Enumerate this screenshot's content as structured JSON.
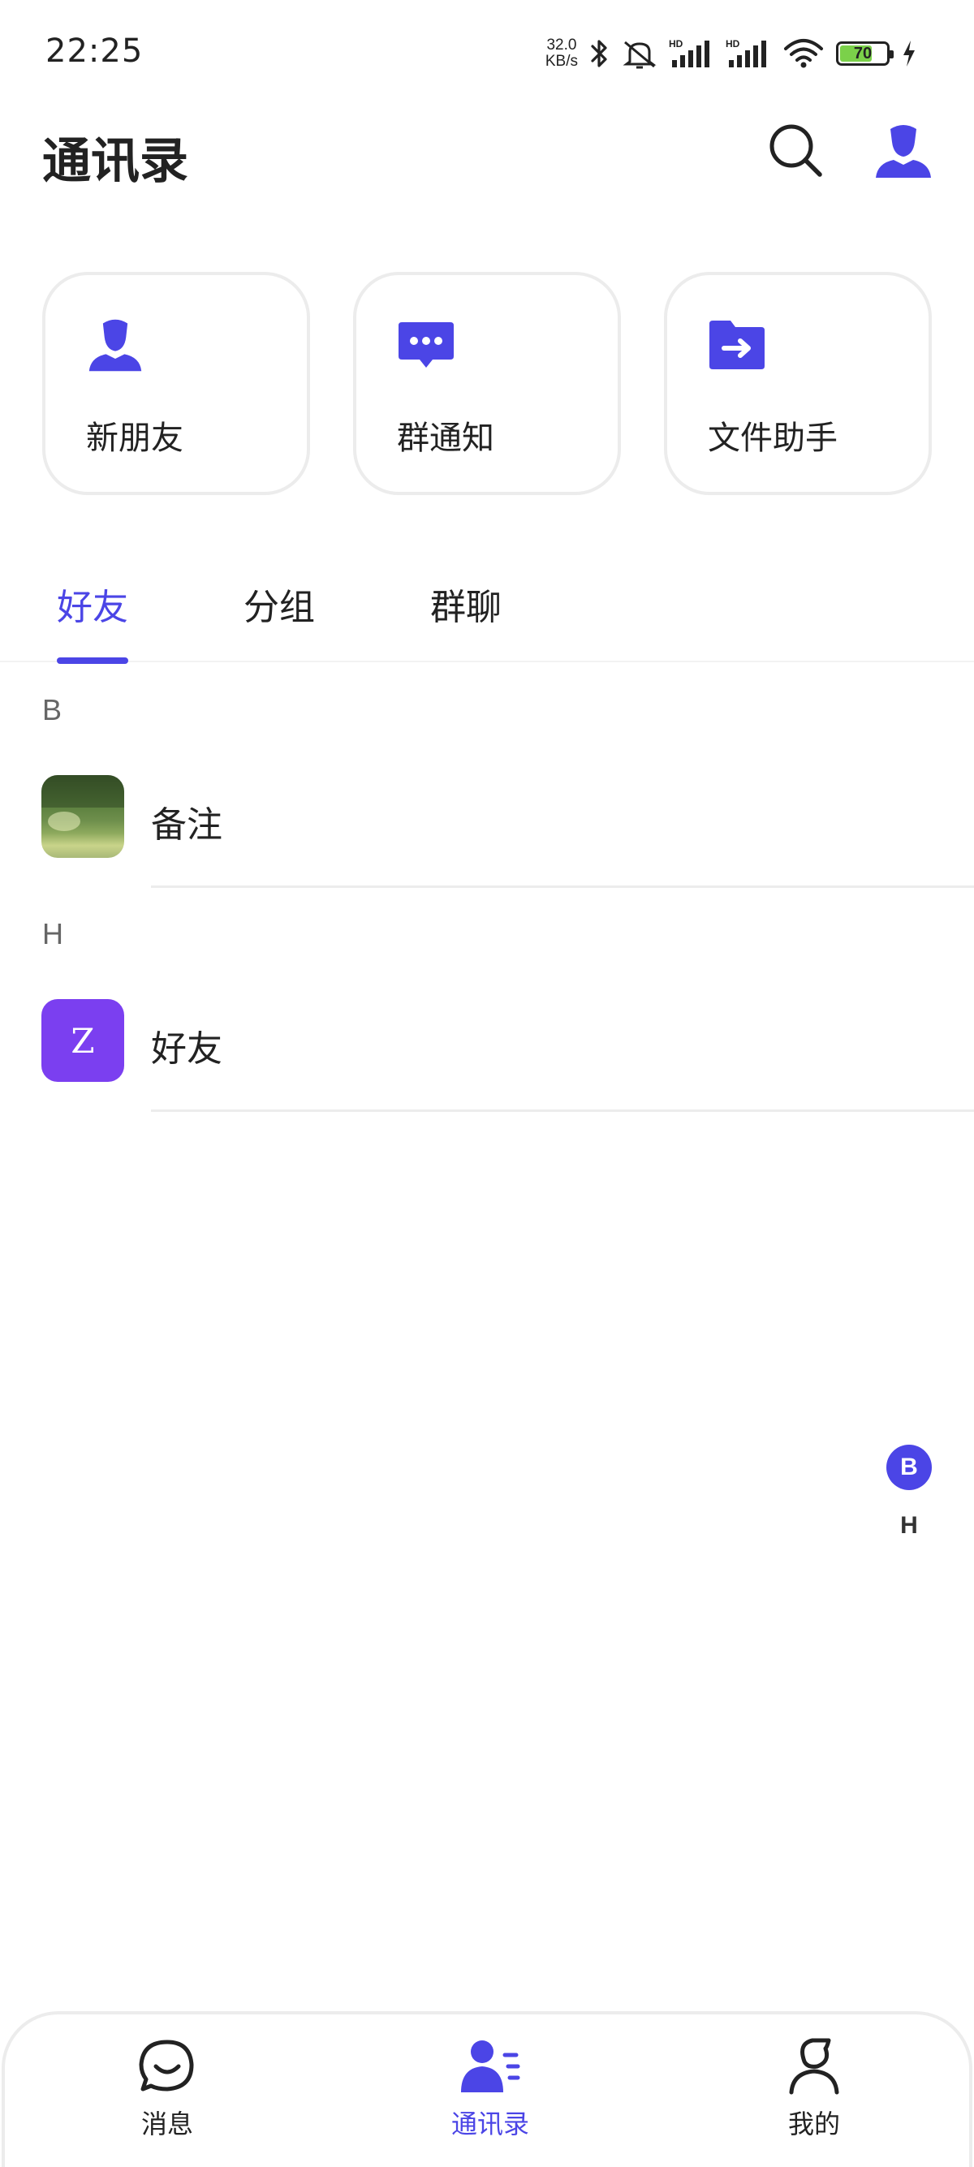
{
  "status_bar": {
    "time": "22:25",
    "net_speed_value": "32.0",
    "net_speed_unit": "KB/s",
    "battery": "70",
    "battery_level": 0.7,
    "icons": [
      "bluetooth-icon",
      "mute-icon",
      "signal-hd-1-icon",
      "signal-hd-2-icon",
      "wifi-icon",
      "battery-icon",
      "charging-icon"
    ],
    "battery_color": "#7bd14a"
  },
  "header": {
    "title": "通讯录",
    "icons": [
      "search-icon",
      "profile-icon"
    ]
  },
  "quick_cards": [
    {
      "label": "新朋友",
      "icon": "new-friend-icon"
    },
    {
      "label": "群通知",
      "icon": "group-notice-icon"
    },
    {
      "label": "文件助手",
      "icon": "file-assistant-icon"
    }
  ],
  "tabs": [
    {
      "label": "好友",
      "active": true
    },
    {
      "label": "分组",
      "active": false
    },
    {
      "label": "群聊",
      "active": false
    }
  ],
  "contacts": {
    "sections": [
      {
        "letter": "B",
        "items": [
          {
            "name": "备注",
            "avatar": "photo"
          }
        ]
      },
      {
        "letter": "H",
        "items": [
          {
            "name": "好友",
            "avatar": "letter",
            "avatar_letter": "Z"
          }
        ]
      }
    ]
  },
  "index_bar": {
    "letters": [
      "B",
      "H"
    ],
    "active": "B"
  },
  "bottom_nav": [
    {
      "label": "消息",
      "icon": "chat-icon",
      "active": false
    },
    {
      "label": "通讯录",
      "icon": "contacts-icon",
      "active": true
    },
    {
      "label": "我的",
      "icon": "me-icon",
      "active": false
    }
  ],
  "colors": {
    "accent": "#4b45e6",
    "avatar_letter_bg": "#7b3ff0",
    "text": "#222222",
    "card_border": "#ececec"
  }
}
